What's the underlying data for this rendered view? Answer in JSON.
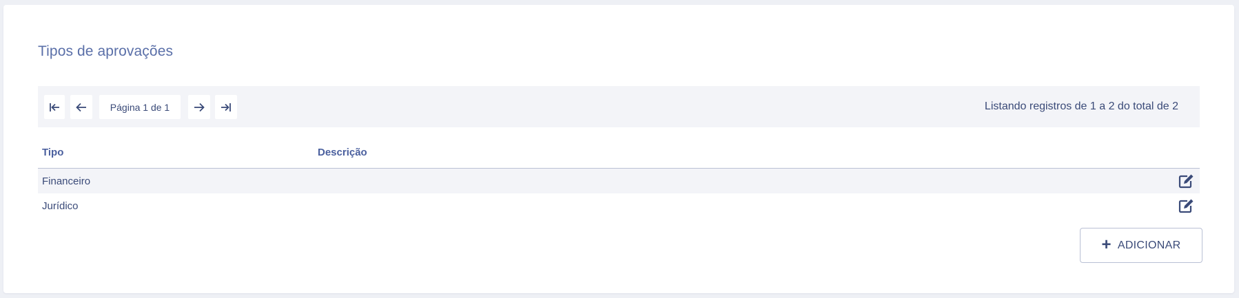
{
  "page": {
    "title": "Tipos de aprovações"
  },
  "pagination": {
    "first_icon": "first-page-icon",
    "prev_icon": "arrow-left-icon",
    "page_label": "Página 1 de 1",
    "next_icon": "arrow-right-icon",
    "last_icon": "last-page-icon",
    "listing_info": "Listando registros de 1 a 2 do total de 2"
  },
  "table": {
    "columns": [
      "Tipo",
      "Descrição"
    ],
    "rows": [
      {
        "tipo": "Financeiro",
        "descricao": "",
        "action_icon": "edit-icon"
      },
      {
        "tipo": "Jurídico",
        "descricao": "",
        "action_icon": "edit-icon"
      }
    ]
  },
  "actions": {
    "add_label": "ADICIONAR",
    "add_icon": "plus-icon"
  },
  "colors": {
    "accent": "#3a4a78",
    "title": "#5a6fa8",
    "toolbar_bg": "#f3f4f8",
    "page_bg": "#eef0f5"
  }
}
